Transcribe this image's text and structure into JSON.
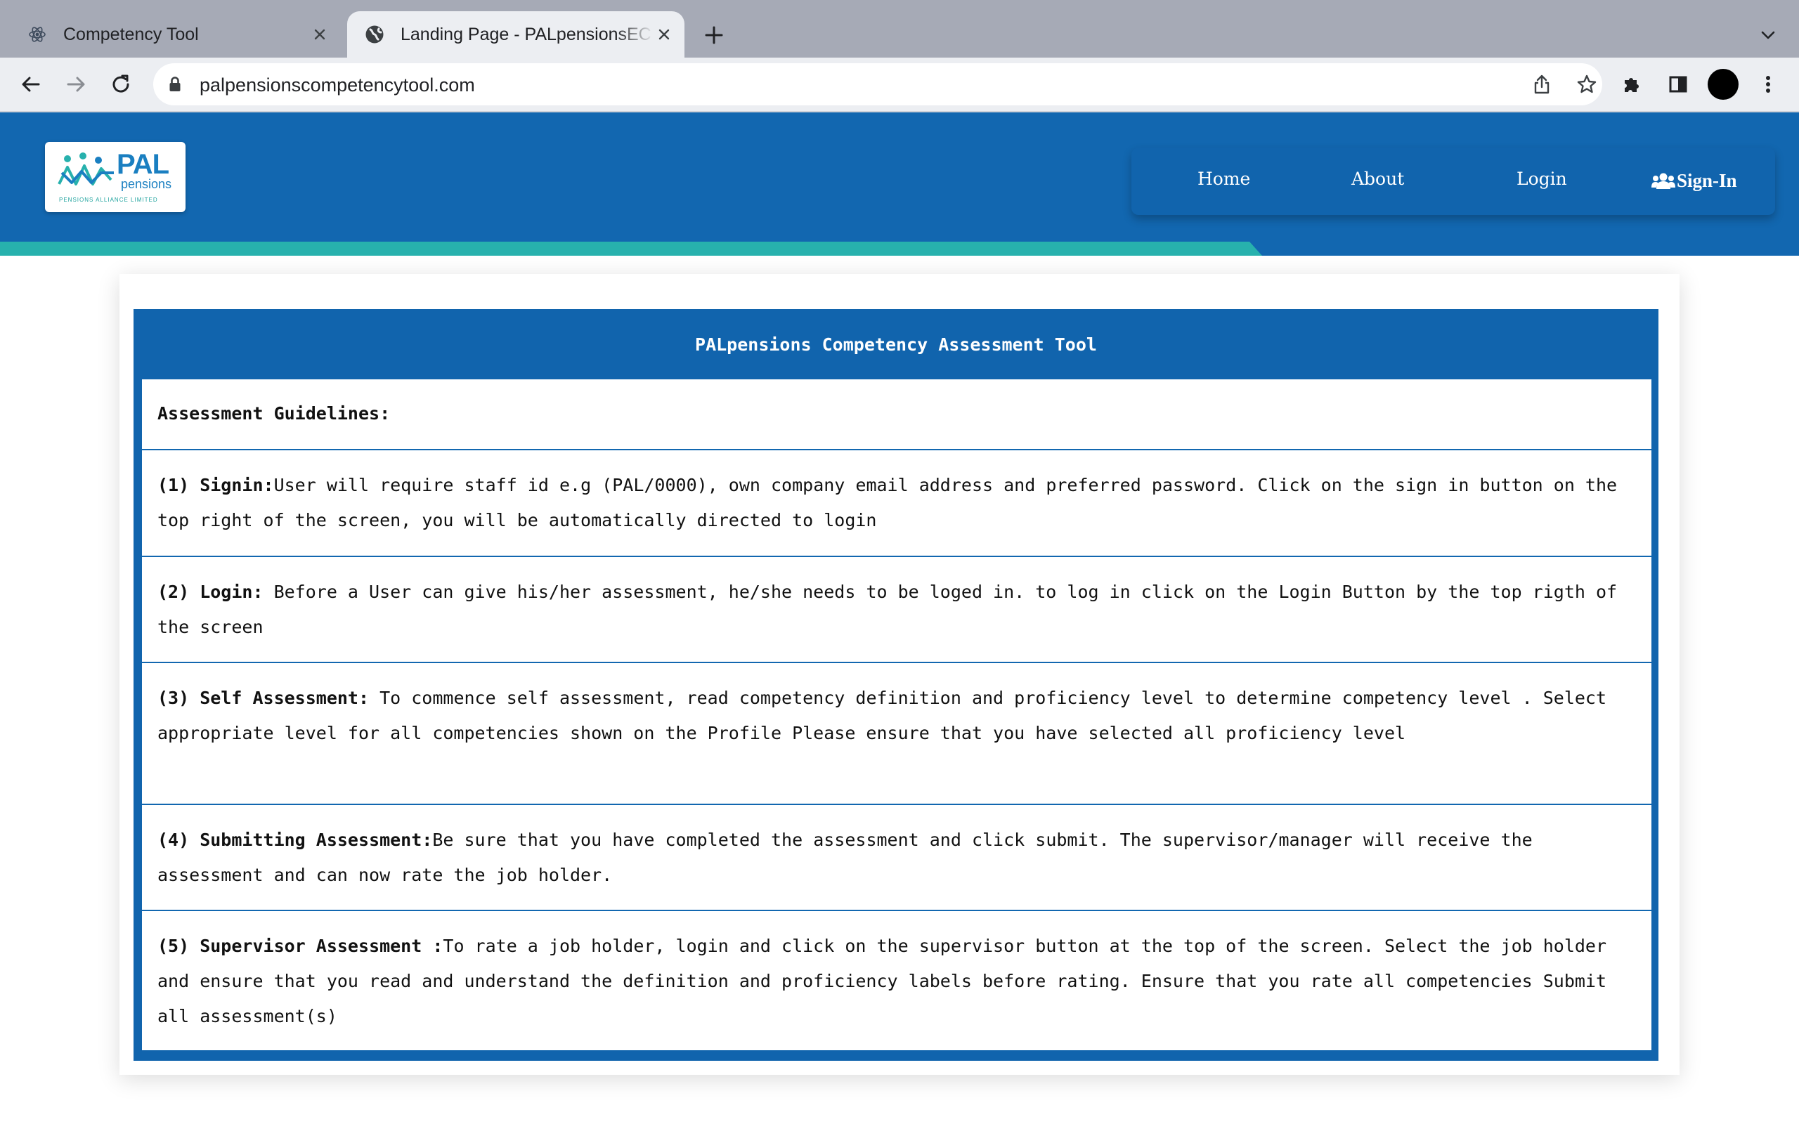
{
  "browser": {
    "tabs": [
      {
        "title": "Competency Tool",
        "active": false
      },
      {
        "title": "Landing Page - PALpensionsEC",
        "active": true
      }
    ],
    "url": "palpensionscompetencytool.com"
  },
  "header": {
    "logo": {
      "brand": "PAL",
      "sub": "pensions",
      "tagline": "PENSIONS ALLIANCE LIMITED"
    },
    "nav": {
      "home": "Home",
      "about": "About",
      "login": "Login",
      "signin": "Sign-In"
    }
  },
  "main": {
    "title": "PALpensions Competency Assessment Tool",
    "guidelines_heading": "Assessment Guidelines:",
    "guidelines": [
      {
        "label": "(1) Signin:",
        "text": "User will require staff id e.g (PAL/0000), own company email address and preferred password. Click on the sign in button on the top right of the screen, you will be automatically directed to login"
      },
      {
        "label": "(2) Login:",
        "text": " Before a User can give his/her assessment, he/she needs to be loged in. to log in click on the Login Button by the top rigth of the screen"
      },
      {
        "label": "(3) Self Assessment:",
        "text": " To commence self assessment, read competency definition and proficiency level to determine competency level . Select appropriate level for all competencies shown on the Profile Please ensure that you have selected all proficiency level"
      },
      {
        "label": "(4) Submitting Assessment:",
        "text": "Be sure that you have completed the assessment and click submit. The supervisor/manager will receive the assessment and can now rate the job holder."
      },
      {
        "label": "(5) Supervisor Assessment :",
        "text": "To rate a job holder, login and click on the supervisor button at the top of the screen. Select the job holder and ensure that you read and understand the definition and proficiency labels before rating. Ensure that you rate all competencies Submit all assessment(s)"
      }
    ]
  },
  "colors": {
    "header_blue": "#1267b0",
    "teal": "#27b1ad",
    "chrome_tabstrip": "#a6aab6",
    "chrome_toolbar": "#eceef2"
  }
}
